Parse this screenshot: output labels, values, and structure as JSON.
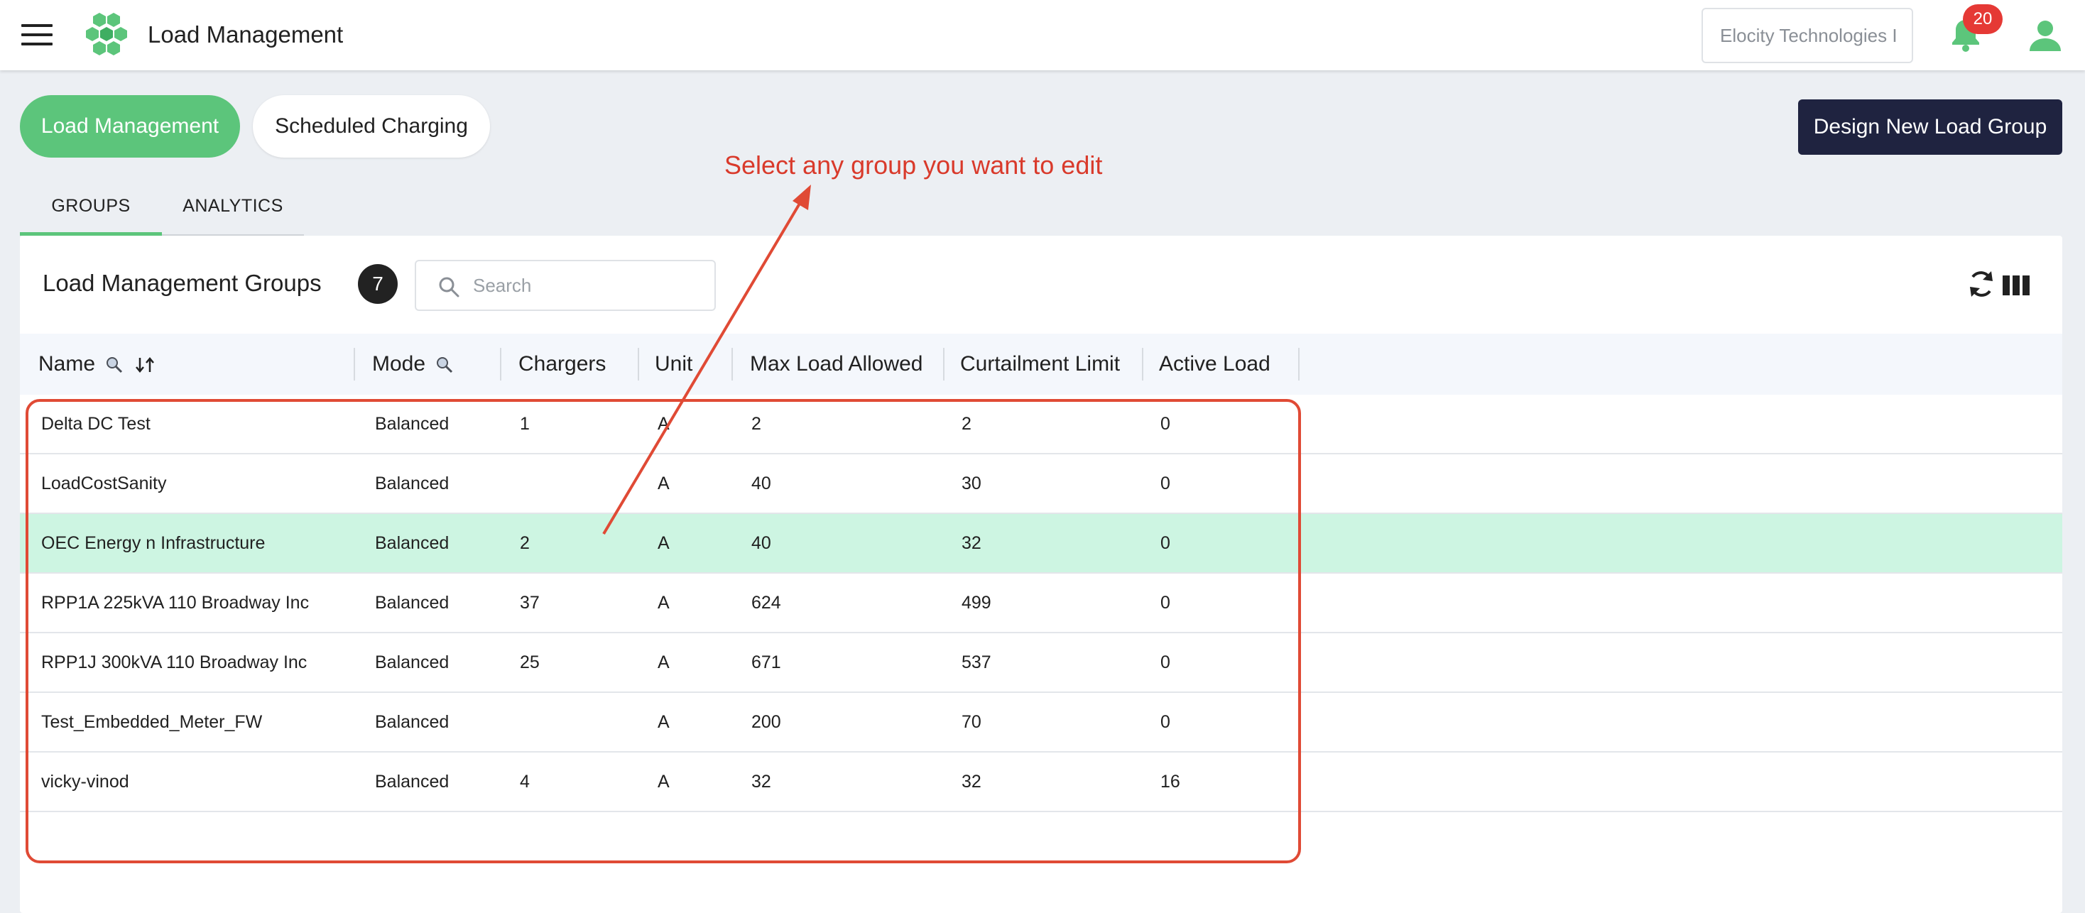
{
  "app": {
    "title": "Load Management",
    "org_selector_value": "Elocity Technologies I",
    "notification_count": "20"
  },
  "top_tabs": {
    "active_label": "Load Management",
    "inactive_label": "Scheduled Charging"
  },
  "actions": {
    "design_new_label": "Design New Load Group"
  },
  "annotation": {
    "text": "Select any group you want to edit",
    "color": "#d93a2b"
  },
  "sub_tabs": {
    "groups_label": "GROUPS",
    "analytics_label": "ANALYTICS"
  },
  "panel": {
    "title": "Load Management Groups",
    "count": "7",
    "search_placeholder": "Search"
  },
  "table": {
    "columns": [
      "Name",
      "Mode",
      "Chargers",
      "Unit",
      "Max Load Allowed",
      "Curtailment Limit",
      "Active Load"
    ],
    "highlight_row_index": 2,
    "rows": [
      {
        "name": "Delta DC Test",
        "mode": "Balanced",
        "chargers": "1",
        "unit": "A",
        "max_load": "2",
        "curtailment": "2",
        "active_load": "0"
      },
      {
        "name": "LoadCostSanity",
        "mode": "Balanced",
        "chargers": "",
        "unit": "A",
        "max_load": "40",
        "curtailment": "30",
        "active_load": "0"
      },
      {
        "name": "OEC Energy n Infrastructure",
        "mode": "Balanced",
        "chargers": "2",
        "unit": "A",
        "max_load": "40",
        "curtailment": "32",
        "active_load": "0"
      },
      {
        "name": "RPP1A 225kVA 110 Broadway Inc",
        "mode": "Balanced",
        "chargers": "37",
        "unit": "A",
        "max_load": "624",
        "curtailment": "499",
        "active_load": "0"
      },
      {
        "name": "RPP1J 300kVA 110 Broadway Inc",
        "mode": "Balanced",
        "chargers": "25",
        "unit": "A",
        "max_load": "671",
        "curtailment": "537",
        "active_load": "0"
      },
      {
        "name": "Test_Embedded_Meter_FW",
        "mode": "Balanced",
        "chargers": "",
        "unit": "A",
        "max_load": "200",
        "curtailment": "70",
        "active_load": "0"
      },
      {
        "name": "vicky-vinod",
        "mode": "Balanced",
        "chargers": "4",
        "unit": "A",
        "max_load": "32",
        "curtailment": "32",
        "active_load": "16"
      }
    ]
  },
  "colors": {
    "accent_green": "#5cc57b",
    "row_highlight": "#cdf5e2",
    "primary_dark": "#1f2340",
    "badge_red": "#e53935"
  },
  "icons": [
    "menu-icon",
    "hexagon-logo",
    "bell-icon",
    "user-icon",
    "search-icon",
    "refresh-icon",
    "columns-icon",
    "sort-icon"
  ]
}
